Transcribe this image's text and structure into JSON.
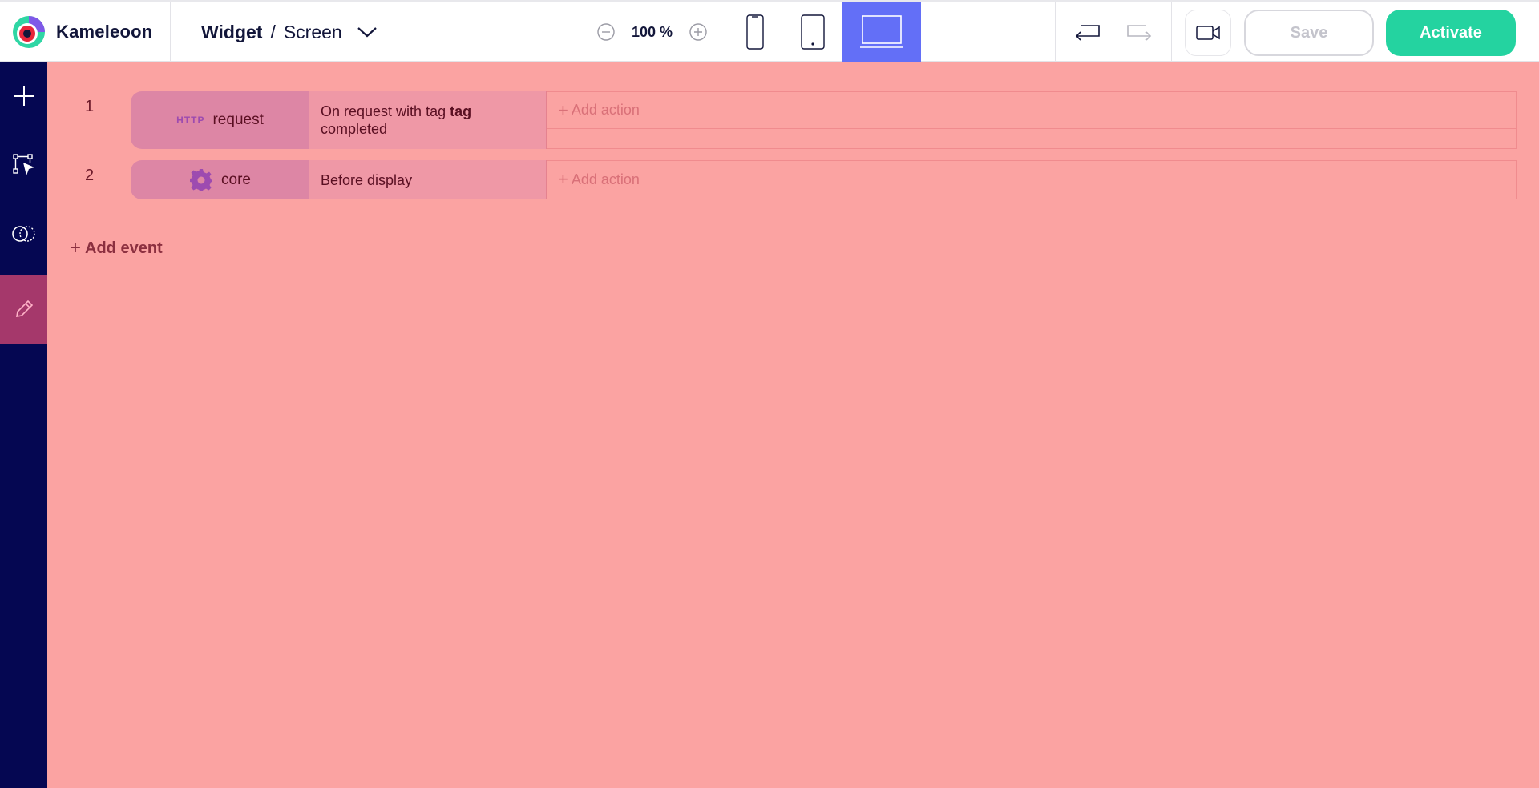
{
  "app": {
    "name": "Kameleoon",
    "colors": {
      "sidebar": "#050752",
      "active_sidebar": "#a5386b",
      "canvas": "#fba3a2",
      "accent": "#636ff7",
      "activate": "#24d3a0"
    }
  },
  "breadcrumb": {
    "item": "Widget",
    "separator": "/",
    "current": "Screen",
    "dropdown_icon": "chevron-down-icon"
  },
  "zoom": {
    "value": "100 %",
    "decrease_icon": "zoom-out-icon",
    "increase_icon": "zoom-in-icon"
  },
  "devices": [
    {
      "name": "mobile",
      "icon": "phone-icon",
      "selected": false
    },
    {
      "name": "tablet",
      "icon": "tablet-icon",
      "selected": false
    },
    {
      "name": "desktop",
      "icon": "laptop-icon",
      "selected": true
    }
  ],
  "history": {
    "undo_icon": "undo-icon",
    "redo_icon": "redo-icon"
  },
  "toolbar": {
    "video_icon": "video-camera-icon",
    "save_label": "Save",
    "activate_label": "Activate"
  },
  "sidebar": {
    "items": [
      {
        "icon": "plus-icon",
        "active": false
      },
      {
        "icon": "select-element-icon",
        "active": false
      },
      {
        "icon": "circles-icon",
        "active": false
      },
      {
        "icon": "pencil-icon",
        "active": true
      }
    ]
  },
  "events": [
    {
      "number": "1",
      "source_badge": "HTTP",
      "source": "request",
      "description_prefix": "On request with tag",
      "description_bold": "tag",
      "description_suffix": "completed",
      "add_action_label": "Add action"
    },
    {
      "number": "2",
      "source_icon": "gear-icon",
      "source": "core",
      "description_prefix": "Before display",
      "add_action_label": "Add action"
    }
  ],
  "add_event_label": "Add event"
}
